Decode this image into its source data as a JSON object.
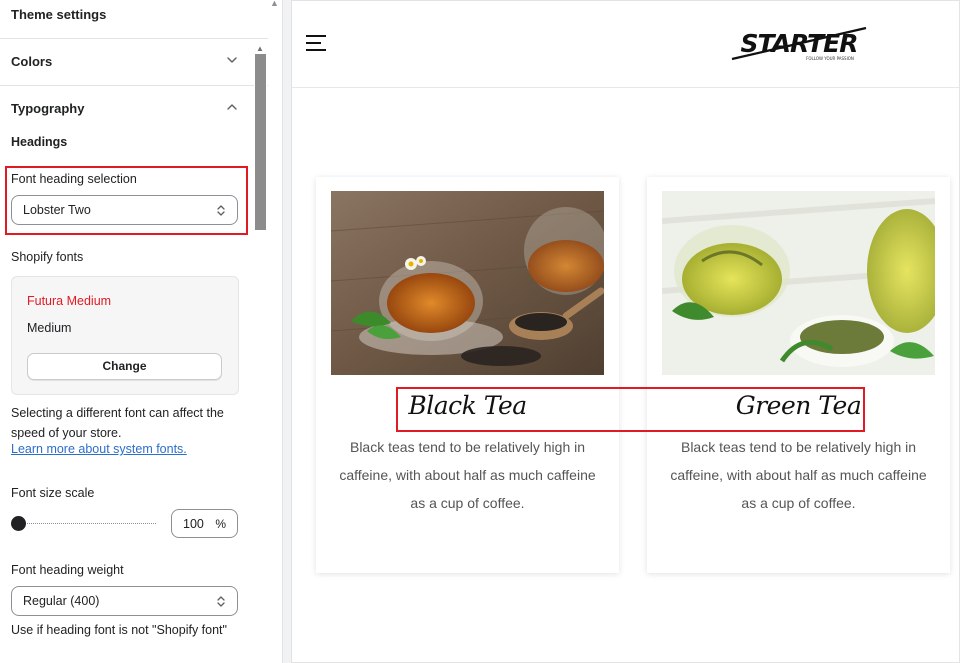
{
  "panel": {
    "title": "Theme settings",
    "sections": {
      "colors": "Colors",
      "typography": "Typography"
    },
    "headings_label": "Headings",
    "font_heading_selection": {
      "label": "Font heading selection",
      "value": "Lobster Two"
    },
    "shopify_fonts": {
      "label": "Shopify fonts",
      "font_name": "Futura Medium",
      "font_style": "Medium",
      "change_label": "Change"
    },
    "font_help": "Selecting a different font can affect the speed of your store.",
    "font_help_link": "Learn more about system fonts.",
    "font_size_scale": {
      "label": "Font size scale",
      "value": "100",
      "unit": "%",
      "level": 0.0
    },
    "font_heading_weight": {
      "label": "Font heading weight",
      "value": "Regular (400)",
      "help": "Use if heading font is not \"Shopify font\""
    }
  },
  "store": {
    "logo_text": "STARTER",
    "logo_tagline": "FOLLOW YOUR PASSION",
    "cards": [
      {
        "title": "Black Tea",
        "description": "Black teas tend to be relatively high in caffeine, with about half as much caffeine as a cup of coffee."
      },
      {
        "title": "Green Tea",
        "description": "Black teas tend to be relatively high in caffeine, with about half as much caffeine as a cup of coffee."
      }
    ]
  },
  "colors": {
    "highlight": "#e01b24",
    "link": "#2c6ecb",
    "font_name_red": "#e01b24",
    "scrollbar": "#8c8c8c"
  },
  "icons": [
    "chevron-down-icon",
    "chevron-up-icon",
    "select-arrows-icon",
    "hamburger-menu-icon",
    "starter-logo"
  ]
}
